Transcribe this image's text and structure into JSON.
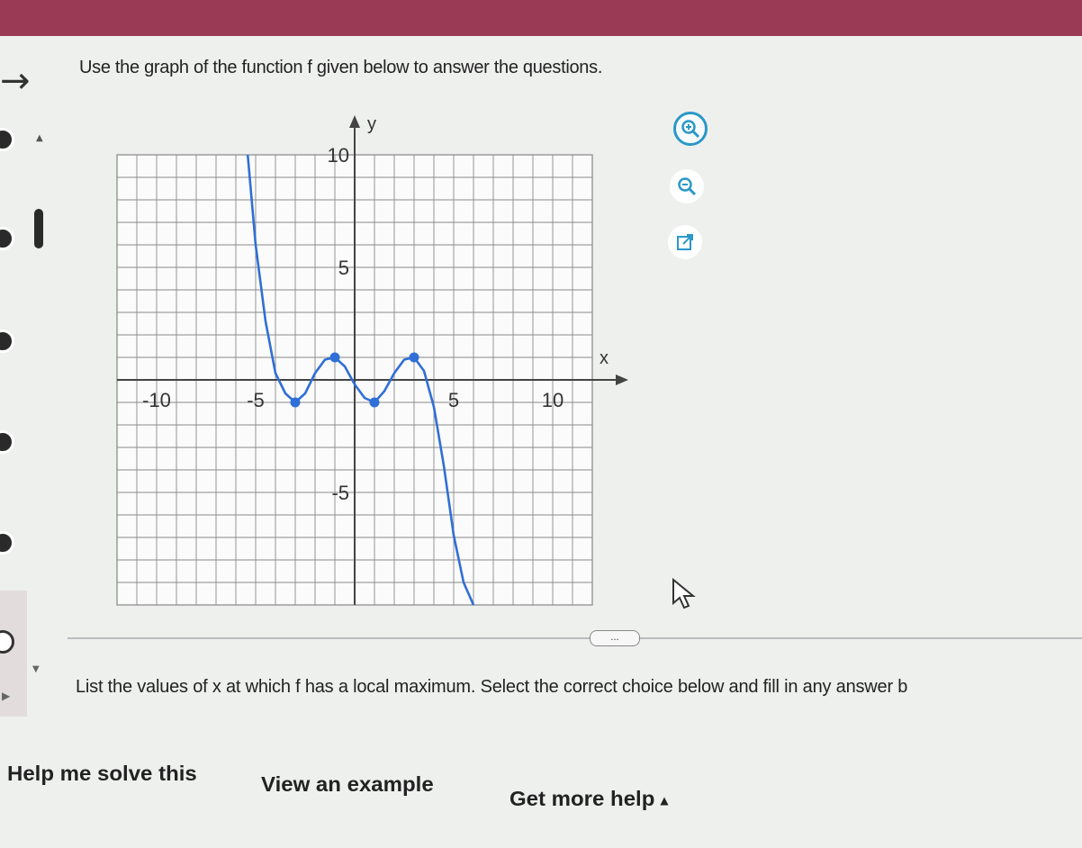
{
  "prompt": "Use the graph of the function f given below to answer the questions.",
  "question": "List the values of x at which f has a local maximum. Select the correct choice below and fill in any answer b",
  "help_bar": {
    "help_me_solve": "Help me solve this",
    "view_example": "View an example",
    "get_more_help": "Get more help"
  },
  "divider": {
    "ellipsis": "..."
  },
  "tools": {
    "zoom_in": "zoom-in-icon",
    "zoom_out": "zoom-out-icon",
    "popout": "external-window-icon"
  },
  "colors": {
    "curve": "#2f6fd6",
    "topbar": "#9a3a55",
    "tool_ring": "#2a98c8"
  },
  "chart_data": {
    "type": "line",
    "xlabel": "x",
    "ylabel": "y",
    "xlim": [
      -12,
      12
    ],
    "ylim": [
      -10,
      10
    ],
    "grid": true,
    "x_tick_labels": [
      "-10",
      "-5",
      "5",
      "10"
    ],
    "y_tick_labels": [
      "10",
      "5",
      "-5"
    ],
    "series": [
      {
        "x": [
          -5.4,
          -5.0,
          -4.5,
          -4.0,
          -3.5,
          -3.0,
          -2.5,
          -2.0,
          -1.5,
          -1.0,
          -0.5,
          0.0,
          0.5,
          1.0,
          1.5,
          2.0,
          2.5,
          3.0,
          3.5,
          4.0,
          4.5,
          5.0,
          5.5,
          6.0
        ],
        "y": [
          10.0,
          6.0,
          2.6,
          0.3,
          -0.6,
          -1.0,
          -0.6,
          0.3,
          0.9,
          1.0,
          0.6,
          -0.2,
          -0.8,
          -1.0,
          -0.5,
          0.3,
          0.9,
          1.0,
          0.4,
          -1.2,
          -3.8,
          -6.9,
          -9.0,
          -10.0
        ]
      }
    ],
    "marked_points": [
      {
        "x": -3,
        "y": -1
      },
      {
        "x": -1,
        "y": 1
      },
      {
        "x": 1,
        "y": -1
      },
      {
        "x": 3,
        "y": 1
      }
    ]
  }
}
